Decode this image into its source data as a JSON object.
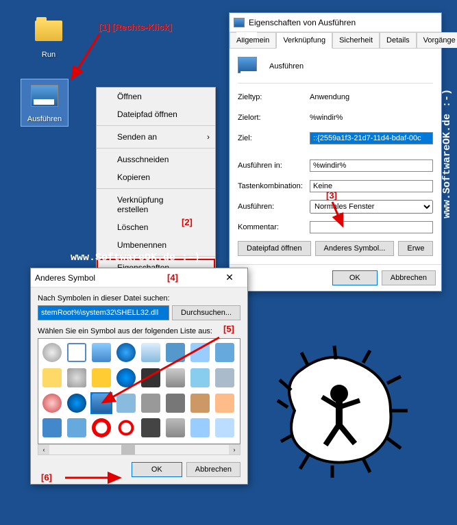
{
  "desktop": {
    "icons": [
      {
        "name": "run-folder",
        "label": "Run"
      },
      {
        "name": "ausfuhren-shortcut",
        "label": "Ausführen"
      }
    ]
  },
  "context_menu": {
    "items": [
      {
        "label": "Öffnen"
      },
      {
        "label": "Dateipfad öffnen"
      },
      {
        "label": "Senden an",
        "submenu": true
      },
      {
        "label": "Ausschneiden"
      },
      {
        "label": "Kopieren"
      },
      {
        "label": "Verknüpfung erstellen"
      },
      {
        "label": "Löschen"
      },
      {
        "label": "Umbenennen"
      },
      {
        "label": "Eigenschaften"
      }
    ]
  },
  "properties": {
    "title": "Eigenschaften von Ausführen",
    "tabs": [
      "Allgemein",
      "Verknüpfung",
      "Sicherheit",
      "Details",
      "Vorgänge"
    ],
    "active_tab": "Verknüpfung",
    "name": "Ausführen",
    "fields": {
      "zieltyp_label": "Zieltyp:",
      "zieltyp_value": "Anwendung",
      "zielort_label": "Zielort:",
      "zielort_value": "%windir%",
      "ziel_label": "Ziel:",
      "ziel_value": "::{2559a1f3-21d7-11d4-bdaf-00c",
      "ausfuhren_in_label": "Ausführen in:",
      "ausfuhren_in_value": "%windir%",
      "tastenkombination_label": "Tastenkombination:",
      "tastenkombination_value": "Keine",
      "ausfuhren_label": "Ausführen:",
      "ausfuhren_value": "Normales Fenster",
      "kommentar_label": "Kommentar:",
      "kommentar_value": ""
    },
    "buttons": {
      "dateipfad": "Dateipfad öffnen",
      "anderes_symbol": "Anderes Symbol...",
      "erweitert": "Erwe",
      "ok": "OK",
      "abbrechen": "Abbrechen"
    }
  },
  "icon_dialog": {
    "title": "Anderes Symbol",
    "search_label": "Nach Symbolen in dieser Datei suchen:",
    "search_value": "stemRoot%\\system32\\SHELL32.dll",
    "browse": "Durchsuchen...",
    "list_label": "Wählen Sie ein Symbol aus der folgenden Liste aus:",
    "ok": "OK",
    "abbrechen": "Abbrechen"
  },
  "annotations": {
    "a1": "[1]  [Rechts-Klick]",
    "a2": "[2]",
    "a3": "[3]",
    "a4": "[4]",
    "a5": "[5]",
    "a6": "[6]"
  },
  "url": "www.SoftwareOK.de :-)"
}
